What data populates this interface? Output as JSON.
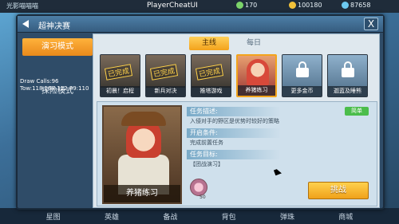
{
  "topbar": {
    "left_text": "光影喵喵喵",
    "center_text": "PlayerCheatUI",
    "resources": [
      {
        "name": "stamina",
        "value": "170",
        "color": "#7bd36a"
      },
      {
        "name": "gold",
        "value": "100180",
        "color": "#f2c23a"
      },
      {
        "name": "diamond",
        "value": "87658",
        "color": "#6cc9f0"
      }
    ]
  },
  "dialog": {
    "title": "超神决赛",
    "close_label": "X"
  },
  "side_menu": {
    "items": [
      {
        "label": "演习模式",
        "active": true
      },
      {
        "label": "",
        "active": false
      },
      {
        "label": "探险模式",
        "active": false
      }
    ],
    "debug_line1": "Draw Calls:96",
    "debug_line2": "Tow:118.168.112.89:110"
  },
  "tabs": [
    {
      "label": "主线",
      "active": true
    },
    {
      "label": "每日",
      "active": false
    }
  ],
  "cards": [
    {
      "name": "初晨！启程",
      "status": "已完成",
      "type": "completed"
    },
    {
      "name": "新兵对决",
      "status": "已完成",
      "type": "completed"
    },
    {
      "name": "推塔游戏",
      "status": "已完成",
      "type": "completed"
    },
    {
      "name": "养猪练习",
      "status": "",
      "type": "selected"
    },
    {
      "name": "更多金币",
      "status": "",
      "type": "locked"
    },
    {
      "name": "迦蓝及睡熊",
      "status": "",
      "type": "locked"
    }
  ],
  "detail": {
    "hero_name": "养猪练习",
    "difficulty": "简单",
    "sections": [
      {
        "label": "任务描述:",
        "text": "入侵对手的野区是优势时较好的策略"
      },
      {
        "label": "开启条件:",
        "text": "完成前置任务"
      },
      {
        "label": "任务目标:",
        "text": "【团战演习】"
      }
    ],
    "reward_count": "50",
    "challenge_label": "挑战"
  },
  "bottom_nav": [
    "星图",
    "英雄",
    "备战",
    "背包",
    "弹珠",
    "商城"
  ]
}
